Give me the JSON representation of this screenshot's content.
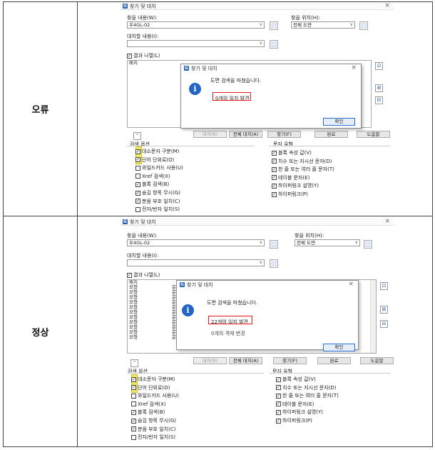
{
  "rows": [
    {
      "label": "오류",
      "dialog": {
        "title": "찾기 및 대치",
        "find_label": "찾을 내용(W):",
        "find_value": "우4GL-02",
        "location_label": "찾을 위치(H):",
        "location_value": "전체 도면",
        "replace_label": "대치할 내용(I):",
        "replace_value": "",
        "list_results_label": "결과 나열(L)",
        "result_columns": [
          "배치",
          "객체 유형",
          "내용"
        ],
        "result_rows": [],
        "buttons": {
          "replace": "대치(R)",
          "replace_all": "전체 대치(A)",
          "find": "찾기(F)",
          "done": "완료",
          "help": "도움말"
        },
        "search_options_label": "검색 옵션",
        "search_options": [
          {
            "label": "대소문자 구분(M)",
            "checked": true
          },
          {
            "label": "단어 단위로(O)",
            "checked": true
          },
          {
            "label": "와일드카드 사용(U)",
            "checked": false
          },
          {
            "label": "Xref 검색(X)",
            "checked": false
          },
          {
            "label": "블록 검색(B)",
            "checked": true
          },
          {
            "label": "숨김 항목 무시(G)",
            "checked": true
          },
          {
            "label": "분음 부호 일치(C)",
            "checked": true
          },
          {
            "label": "전자/반자 일치(S)",
            "checked": false
          }
        ],
        "text_types_label": "문자 유형",
        "text_types": [
          {
            "label": "블록 속성 값(V)",
            "checked": true
          },
          {
            "label": "치수 또는 지시선 문자(D)",
            "checked": true
          },
          {
            "label": "한 줄 또는 여러 줄 문자(T)",
            "checked": true
          },
          {
            "label": "테이블 문자(E)",
            "checked": true
          },
          {
            "label": "하이퍼링크 설명(Y)",
            "checked": true
          },
          {
            "label": "하이퍼링크(P)",
            "checked": true
          }
        ]
      },
      "popup": {
        "title": "찾기 및 대치",
        "message": "도면 검색을 마쳤습니다.",
        "result": "0개의 일치 발견",
        "extra": "",
        "ok": "확인"
      }
    },
    {
      "label": "정상",
      "dialog": {
        "title": "찾기 및 대치",
        "find_label": "찾을 내용(W):",
        "find_value": "우4GL-02",
        "location_label": "찾을 위치(H):",
        "location_value": "전체 도면",
        "replace_label": "대치할 내용(I):",
        "replace_value": "",
        "list_results_label": "결과 나열(L)",
        "result_columns": [
          "배치",
          "객체 유형",
          "내용"
        ],
        "result_rows": [
          "모형",
          "모형",
          "모형",
          "모형",
          "모형",
          "모형",
          "모형",
          "모형",
          "모형",
          "모형",
          "모형"
        ],
        "result_types": [
          "문",
          "문",
          "문",
          "문",
          "문",
          "문",
          "문",
          "문",
          "문",
          "문",
          "문"
        ],
        "buttons": {
          "replace": "대치(R)",
          "replace_all": "전체 대치(A)",
          "find": "찾기(F)",
          "done": "완료",
          "help": "도움말"
        },
        "search_options_label": "검색 옵션",
        "search_options": [
          {
            "label": "대소문자 구분(M)",
            "checked": true
          },
          {
            "label": "단어 단위로(O)",
            "checked": true
          },
          {
            "label": "와일드카드 사용(U)",
            "checked": false
          },
          {
            "label": "Xref 검색(X)",
            "checked": false
          },
          {
            "label": "블록 검색(B)",
            "checked": true
          },
          {
            "label": "숨김 항목 무시(G)",
            "checked": true
          },
          {
            "label": "분음 부호 일치(C)",
            "checked": true
          },
          {
            "label": "전자/반자 일치(S)",
            "checked": false
          }
        ],
        "text_types_label": "문자 유형",
        "text_types": [
          {
            "label": "블록 속성 값(V)",
            "checked": true
          },
          {
            "label": "치수 또는 지시선 문자(D)",
            "checked": true
          },
          {
            "label": "한 줄 또는 여러 줄 문자(T)",
            "checked": true
          },
          {
            "label": "테이블 문자(E)",
            "checked": true
          },
          {
            "label": "하이퍼링크 설명(Y)",
            "checked": true
          },
          {
            "label": "하이퍼링크(P)",
            "checked": true
          }
        ]
      },
      "popup": {
        "title": "찾기 및 대치",
        "message": "도면 검색을 마쳤습니다.",
        "result": "22개의 일치 발견",
        "extra": "0개의 객체 변경",
        "ok": "확인"
      }
    }
  ],
  "colors": {
    "highlight_yellow": "#f2e54a",
    "highlight_red": "#e41c1c",
    "info_blue": "#2166c5"
  }
}
